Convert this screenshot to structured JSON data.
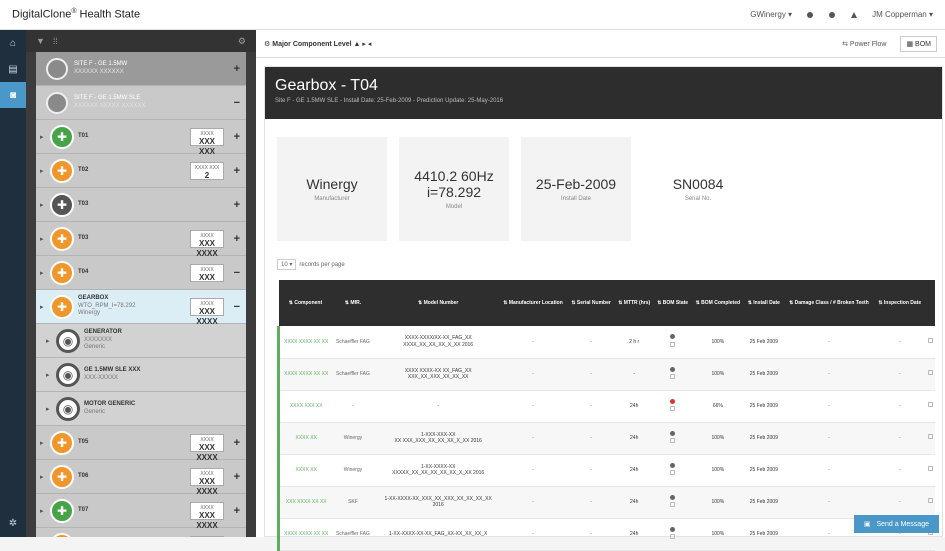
{
  "app": {
    "title": "DigitalClone",
    "title_sup": "®",
    "title_rest": " Health State"
  },
  "topbar": {
    "user_menu": "GWinergy ▾",
    "account": "JM Copperman ▾"
  },
  "tree": {
    "sites": [
      {
        "name": "SITE F - GE 1.5MW",
        "sub": "XXXXXX XXXXXX"
      },
      {
        "name": "SITE F - GE 1.5MW SLE",
        "sub": "XXXXXX XXXXX XXXXXX"
      }
    ],
    "turbines": [
      {
        "label": "T01",
        "color": "green",
        "box_top": "XXXX",
        "box_val": "XXX XXX"
      },
      {
        "label": "T02",
        "color": "orange",
        "box_top": "XXXX XXX",
        "box_val": "2"
      },
      {
        "label": "T03",
        "color": "gray",
        "box_top": "",
        "box_val": ""
      },
      {
        "label": "T03",
        "color": "orange",
        "box_top": "XXXX",
        "box_val": "XXX XXXX"
      },
      {
        "label": "T04",
        "color": "orange",
        "box_top": "XXXX",
        "box_val": "XXX"
      },
      {
        "label": "GEARBOX",
        "sub": "WTO_RPM_I=78.292",
        "sub2": "Winergy",
        "color": "orange",
        "box_top": "XXXX",
        "box_val": "XXX XXXX",
        "selected": true
      },
      {
        "label": "GENERATOR",
        "sub": "XXXXXXX",
        "sub2": "Generic",
        "color": "ring"
      },
      {
        "label": "GE 1.5MW SLE XXX",
        "sub": "XXX-XXXXX",
        "color": "ring"
      },
      {
        "label": "MOTOR GENERIC",
        "sub": "Generic",
        "color": "ring"
      },
      {
        "label": "T05",
        "color": "orange",
        "box_top": "XXXX",
        "box_val": "XXX XXXX"
      },
      {
        "label": "T06",
        "color": "orange",
        "box_top": "XXXX",
        "box_val": "XXX XXXX"
      },
      {
        "label": "T07",
        "color": "green",
        "box_top": "XXXX",
        "box_val": "XXX XXXX"
      },
      {
        "label": "T08",
        "color": "orange",
        "box_top": "XXXX",
        "box_val": "XXX XXXX"
      }
    ]
  },
  "main": {
    "tab_title": "Major Component Level",
    "power_flow": "⇆ Power Flow",
    "bom": "BOM",
    "heading": "Gearbox - T04",
    "meta": "Site F - GE 1.5MW SLE - Install Date: 25-Feb-2009 - Prediction Update: 25-May-2016",
    "cards": [
      {
        "value": "Winergy",
        "label": "Manufacturer"
      },
      {
        "value": "4410.2 60Hz\ni=78.292",
        "label": "Model"
      },
      {
        "value": "25-Feb-2009",
        "label": "Install Date"
      },
      {
        "value": "SN0084",
        "label": "Serial No."
      }
    ],
    "per_page": {
      "select": "10 ▾",
      "text": "records per page"
    },
    "columns": [
      "Component",
      "MfR.",
      "",
      "Model Number",
      "Manufacturer Location",
      "Serial Number",
      "MTTR (hrs)",
      "BOM State",
      "BOM Completed",
      "Install Date",
      "Damage Class / # Broken Teeth",
      "Inspection Date",
      ""
    ],
    "rows": [
      {
        "comp": "XXXX XXXX XX XX",
        "mfr": "Schaeffler FAG",
        "model": "XXXX-XXXX/XX-XX_FAG_XX\nXXXX_XX_XX_XX_X_XX 2016",
        "mloc": "-",
        "serial": "-",
        "mttr": "2 h r",
        "dot": "dark",
        "bomc": "100%",
        "inst": "25 Feb 2009",
        "dmg": "-",
        "insp": "-"
      },
      {
        "comp": "XXXX XXXX XX XX",
        "mfr": "Schaeffler FAG",
        "model": "XXXX XXXX-XX XX_FAG_XX\nXXX_XX_XXX_XX_XX_XX",
        "mloc": "-",
        "serial": "-",
        "mttr": "-",
        "dot": "dark",
        "bomc": "100%",
        "inst": "25 Feb 2009",
        "dmg": "-",
        "insp": "-"
      },
      {
        "comp": "XXXX XXX XX",
        "mfr": "-",
        "model": "-",
        "mloc": "-",
        "serial": "-",
        "mttr": "24h",
        "dot": "red",
        "bomc": "66%",
        "inst": "25 Feb 2009",
        "dmg": "-",
        "insp": "-"
      },
      {
        "comp": "XXXX XX",
        "mfr": "Winergy",
        "model": "1-XXX-XXX-XX\nXX XXX_XXX_XX_XX_XX_X_XX 2016",
        "mloc": "-",
        "serial": "-",
        "mttr": "24h",
        "dot": "dark",
        "bomc": "100%",
        "inst": "25 Feb 2009",
        "dmg": "-",
        "insp": "-"
      },
      {
        "comp": "XXXX XX",
        "mfr": "Winergy",
        "model": "1-XX-XXXX-XX\nXXXXX_XX_XX_XX_XX_XX_X_XX 2016",
        "mloc": "-",
        "serial": "-",
        "mttr": "24h",
        "dot": "dark",
        "bomc": "100%",
        "inst": "25 Feb 2009",
        "dmg": "-",
        "insp": "-"
      },
      {
        "comp": "XXX XXXX XX XX",
        "mfr": "SKF",
        "model": "1-XX-XXXX-XX_XXX_XX_XXX_XX_XX_XX_XX\n2016",
        "mloc": "-",
        "serial": "-",
        "mttr": "24h",
        "dot": "dark",
        "bomc": "100%",
        "inst": "25 Feb 2009",
        "dmg": "-",
        "insp": "-"
      },
      {
        "comp": "XXXX XXXX XX XX",
        "mfr": "Schaeffler FAG",
        "model": "1-XX-XXXX-XX-XX_FAG_XX-XX_XX_XX_X",
        "mloc": "-",
        "serial": "-",
        "mttr": "24h",
        "dot": "dark",
        "bomc": "100%",
        "inst": "25 Feb 2009",
        "dmg": "-",
        "insp": "-"
      }
    ],
    "send_message": "Send a Message"
  }
}
